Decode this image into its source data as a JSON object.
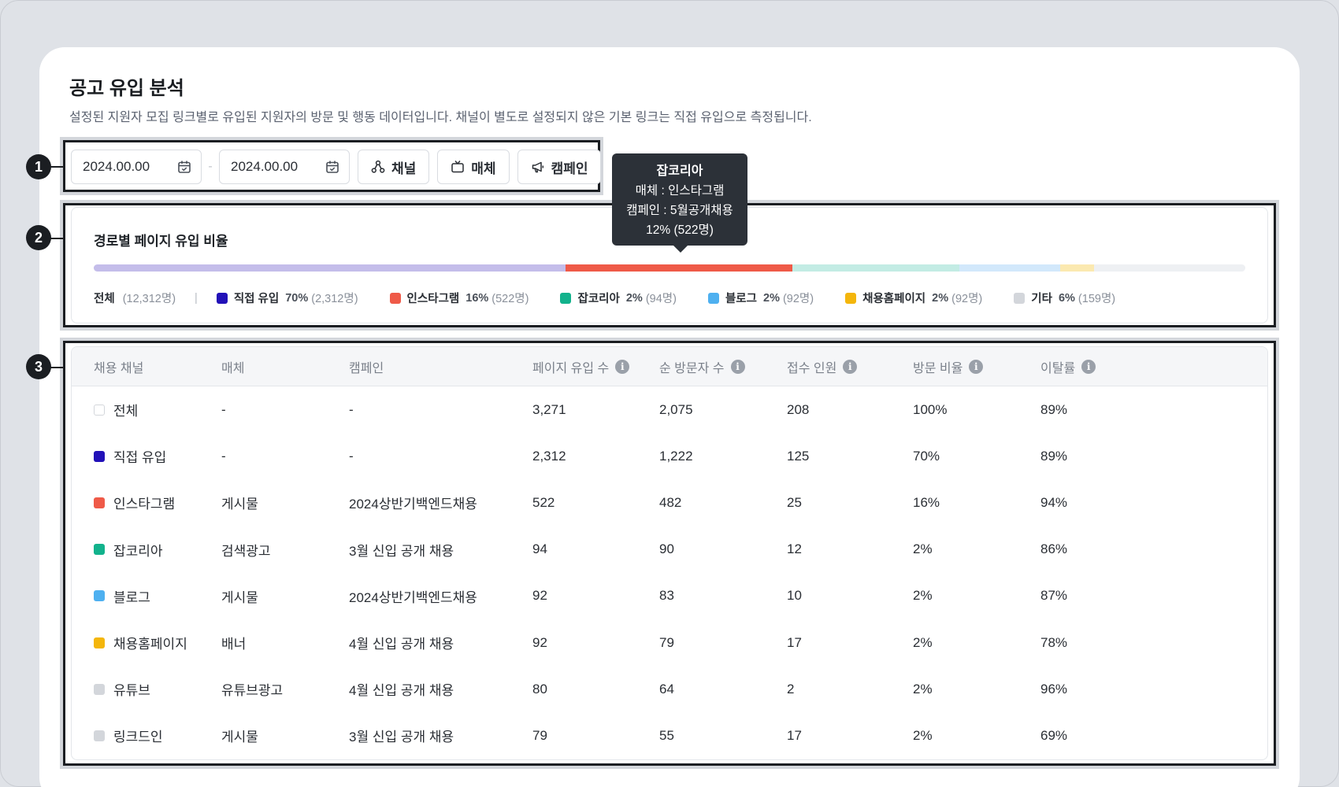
{
  "header": {
    "title": "공고 유입 분석",
    "description": "설정된 지원자 모집 링크별로 유입된 지원자의 방문 및 행동 데이터입니다. 채널이 별도로 설정되지 않은 기본 링크는 직접 유입으로 측정됩니다."
  },
  "markers": [
    "1",
    "2",
    "3"
  ],
  "filters": {
    "start_date": "2024.00.00",
    "end_date": "2024.00.00",
    "separator": "-",
    "channel_label": "채널",
    "media_label": "매체",
    "campaign_label": "캠페인"
  },
  "tooltip": {
    "title": "잡코리아",
    "media": "매체 : 인스타그램",
    "campaign": "캠페인 : 5월공개채용",
    "value": "12% (522명)"
  },
  "ratio": {
    "title": "경로별 페이지 유입 비율",
    "total_label": "전체",
    "total_count": "(12,312명)",
    "bar_segments": [
      {
        "key": "direct",
        "fraction": 0.41,
        "color": "#c4bdea"
      },
      {
        "key": "instagram",
        "fraction": 0.197,
        "color": "#ef5a48"
      },
      {
        "key": "jobkorea",
        "fraction": 0.145,
        "color": "#c3ece4"
      },
      {
        "key": "blog",
        "fraction": 0.087,
        "color": "#d2e8fb"
      },
      {
        "key": "homepage",
        "fraction": 0.03,
        "color": "#fbe9b0"
      },
      {
        "key": "etc",
        "fraction": 0.131,
        "color": "#eef0f3"
      }
    ],
    "legend": [
      {
        "name": "직접 유입",
        "pct": "70%",
        "count": "(2,312명)",
        "color": "#2211b8"
      },
      {
        "name": "인스타그램",
        "pct": "16%",
        "count": "(522명)",
        "color": "#ef5a48"
      },
      {
        "name": "잡코리아",
        "pct": "2%",
        "count": "(94명)",
        "color": "#12b28c"
      },
      {
        "name": "블로그",
        "pct": "2%",
        "count": "(92명)",
        "color": "#4eb0f0"
      },
      {
        "name": "채용홈페이지",
        "pct": "2%",
        "count": "(92명)",
        "color": "#f4b60c"
      },
      {
        "name": "기타",
        "pct": "6%",
        "count": "(159명)",
        "color": "#d3d6db"
      }
    ]
  },
  "table": {
    "headers": [
      "채용 채널",
      "매체",
      "캠페인",
      "페이지 유입 수",
      "순 방문자 수",
      "접수 인원",
      "방문 비율",
      "이탈률"
    ],
    "rows": [
      {
        "channel": "전체",
        "media": "-",
        "campaign": "-",
        "page_views": "3,271",
        "unique_visitors": "2,075",
        "applicants": "208",
        "visit_ratio": "100%",
        "bounce_rate": "89%",
        "color": "#ffffff"
      },
      {
        "channel": "직접 유입",
        "media": "-",
        "campaign": "-",
        "page_views": "2,312",
        "unique_visitors": "1,222",
        "applicants": "125",
        "visit_ratio": "70%",
        "bounce_rate": "89%",
        "color": "#2211b8"
      },
      {
        "channel": "인스타그램",
        "media": "게시물",
        "campaign": "2024상반기백엔드채용",
        "page_views": "522",
        "unique_visitors": "482",
        "applicants": "25",
        "visit_ratio": "16%",
        "bounce_rate": "94%",
        "color": "#ef5a48"
      },
      {
        "channel": "잡코리아",
        "media": "검색광고",
        "campaign": "3월 신입 공개 채용",
        "page_views": "94",
        "unique_visitors": "90",
        "applicants": "12",
        "visit_ratio": "2%",
        "bounce_rate": "86%",
        "color": "#12b28c"
      },
      {
        "channel": "블로그",
        "media": "게시물",
        "campaign": "2024상반기백엔드채용",
        "page_views": "92",
        "unique_visitors": "83",
        "applicants": "10",
        "visit_ratio": "2%",
        "bounce_rate": "87%",
        "color": "#4eb0f0"
      },
      {
        "channel": "채용홈페이지",
        "media": "배너",
        "campaign": "4월 신입 공개 채용",
        "page_views": "92",
        "unique_visitors": "79",
        "applicants": "17",
        "visit_ratio": "2%",
        "bounce_rate": "78%",
        "color": "#f4b60c"
      },
      {
        "channel": "유튜브",
        "media": "유튜브광고",
        "campaign": "4월 신입 공개 채용",
        "page_views": "80",
        "unique_visitors": "64",
        "applicants": "2",
        "visit_ratio": "2%",
        "bounce_rate": "96%",
        "color": "#d3d6db"
      },
      {
        "channel": "링크드인",
        "media": "게시물",
        "campaign": "3월 신입 공개 채용",
        "page_views": "79",
        "unique_visitors": "55",
        "applicants": "17",
        "visit_ratio": "2%",
        "bounce_rate": "69%",
        "color": "#d3d6db"
      }
    ]
  }
}
